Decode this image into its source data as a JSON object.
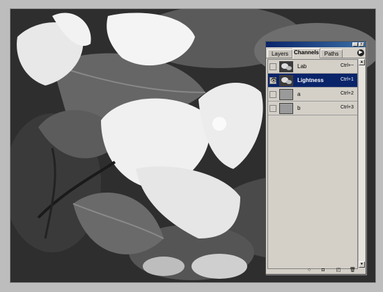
{
  "panel": {
    "tabs": [
      {
        "label": "Layers"
      },
      {
        "label": "Channels"
      },
      {
        "label": "Paths"
      }
    ],
    "active_tab": "Channels",
    "channels": [
      {
        "name": "Lab",
        "shortcut": "Ctrl+~",
        "visible": false,
        "selected": false,
        "thumb": "photo"
      },
      {
        "name": "Lightness",
        "shortcut": "Ctrl+1",
        "visible": true,
        "selected": true,
        "thumb": "photo"
      },
      {
        "name": "a",
        "shortcut": "Ctrl+2",
        "visible": false,
        "selected": false,
        "thumb": "grey"
      },
      {
        "name": "b",
        "shortcut": "Ctrl+3",
        "visible": false,
        "selected": false,
        "thumb": "grey"
      }
    ],
    "icons": {
      "eye": "👁",
      "menu": "▶",
      "minimize": "_",
      "close": "×",
      "scroll_up": "▲",
      "scroll_down": "▼",
      "load_selection": "○",
      "save_selection": "◘",
      "new_channel": "◰",
      "delete": "🗑"
    },
    "accent_color": "#0a246a"
  }
}
